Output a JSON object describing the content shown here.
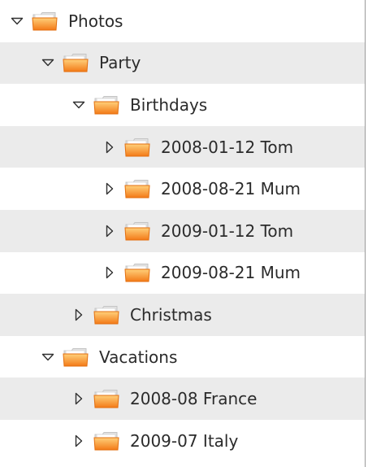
{
  "tree": {
    "rows": [
      {
        "label": "Photos",
        "expanded": true,
        "depth": 0,
        "icon": "folder-icon"
      },
      {
        "label": "Party",
        "expanded": true,
        "depth": 1,
        "icon": "folder-icon"
      },
      {
        "label": "Birthdays",
        "expanded": true,
        "depth": 2,
        "icon": "folder-icon"
      },
      {
        "label": "2008-01-12 Tom",
        "expanded": false,
        "depth": 3,
        "icon": "folder-icon"
      },
      {
        "label": "2008-08-21 Mum",
        "expanded": false,
        "depth": 3,
        "icon": "folder-icon"
      },
      {
        "label": "2009-01-12 Tom",
        "expanded": false,
        "depth": 3,
        "icon": "folder-icon"
      },
      {
        "label": "2009-08-21 Mum",
        "expanded": false,
        "depth": 3,
        "icon": "folder-icon"
      },
      {
        "label": "Christmas",
        "expanded": false,
        "depth": 2,
        "icon": "folder-icon"
      },
      {
        "label": "Vacations",
        "expanded": true,
        "depth": 1,
        "icon": "folder-icon"
      },
      {
        "label": "2008-08 France",
        "expanded": false,
        "depth": 2,
        "icon": "folder-icon"
      },
      {
        "label": "2009-07 Italy",
        "expanded": false,
        "depth": 2,
        "icon": "folder-icon"
      }
    ]
  },
  "colors": {
    "row_alt": "#ebebeb",
    "row_plain": "#ffffff",
    "text": "#2b2b2b",
    "folder_orange": "#f08a24"
  }
}
